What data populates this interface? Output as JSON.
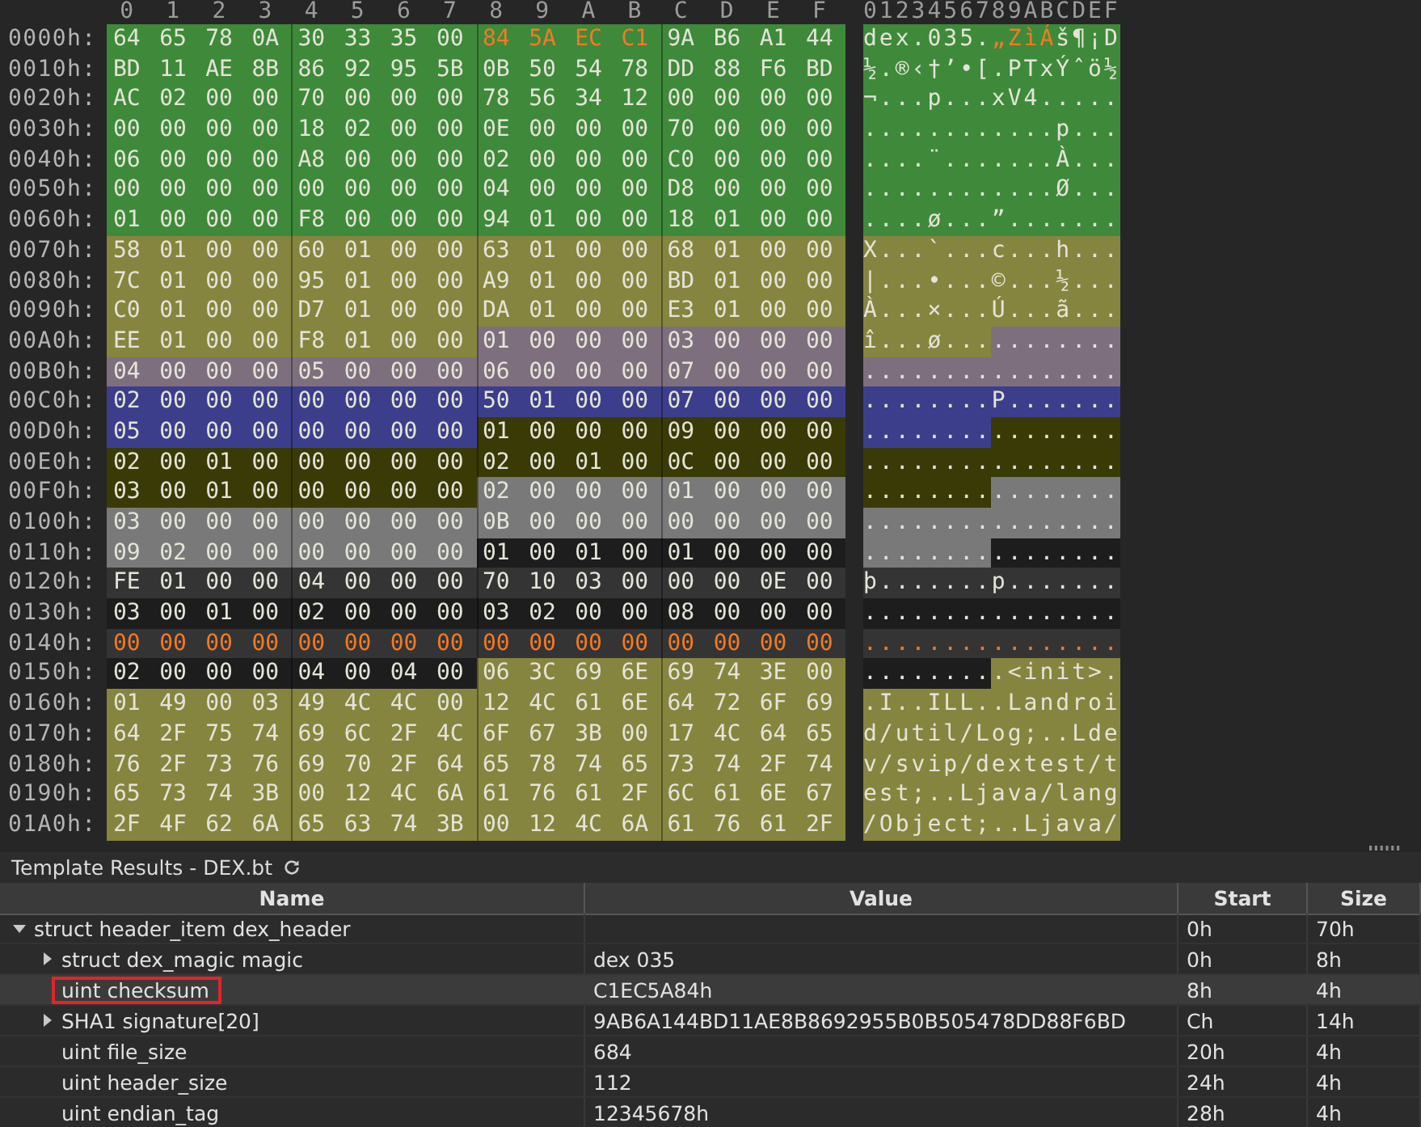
{
  "hex_view": {
    "columns": [
      "0",
      "1",
      "2",
      "3",
      "4",
      "5",
      "6",
      "7",
      "8",
      "9",
      "A",
      "B",
      "C",
      "D",
      "E",
      "F"
    ],
    "ascii_header": "0123456789ABCDEF",
    "rows": [
      {
        "address": "0000h:",
        "spans": [
          {
            "color": "#3e8a3a",
            "selected": false,
            "bytes": [
              "64",
              "65",
              "78",
              "0A",
              "30",
              "33",
              "35",
              "00"
            ],
            "ascii": "dex.035."
          },
          {
            "color": "#3e8a3a",
            "selected": true,
            "bytes": [
              "84",
              "5A",
              "EC",
              "C1"
            ],
            "ascii": "„ZìÁ"
          },
          {
            "color": "#3e8a3a",
            "selected": false,
            "bytes": [
              "9A",
              "B6",
              "A1",
              "44"
            ],
            "ascii": "š¶¡D"
          }
        ]
      },
      {
        "address": "0010h:",
        "spans": [
          {
            "color": "#3e8a3a",
            "selected": false,
            "bytes": [
              "BD",
              "11",
              "AE",
              "8B",
              "86",
              "92",
              "95",
              "5B",
              "0B",
              "50",
              "54",
              "78",
              "DD",
              "88",
              "F6",
              "BD"
            ],
            "ascii": "½.®‹†’•[.PTxÝˆö½"
          }
        ]
      },
      {
        "address": "0020h:",
        "spans": [
          {
            "color": "#3e8a3a",
            "selected": false,
            "bytes": [
              "AC",
              "02",
              "00",
              "00",
              "70",
              "00",
              "00",
              "00",
              "78",
              "56",
              "34",
              "12",
              "00",
              "00",
              "00",
              "00"
            ],
            "ascii": "¬...p...xV4....."
          }
        ]
      },
      {
        "address": "0030h:",
        "spans": [
          {
            "color": "#3e8a3a",
            "selected": false,
            "bytes": [
              "00",
              "00",
              "00",
              "00",
              "18",
              "02",
              "00",
              "00",
              "0E",
              "00",
              "00",
              "00",
              "70",
              "00",
              "00",
              "00"
            ],
            "ascii": "............p..."
          }
        ]
      },
      {
        "address": "0040h:",
        "spans": [
          {
            "color": "#3e8a3a",
            "selected": false,
            "bytes": [
              "06",
              "00",
              "00",
              "00",
              "A8",
              "00",
              "00",
              "00",
              "02",
              "00",
              "00",
              "00",
              "C0",
              "00",
              "00",
              "00"
            ],
            "ascii": "....¨.......À..."
          }
        ]
      },
      {
        "address": "0050h:",
        "spans": [
          {
            "color": "#3e8a3a",
            "selected": false,
            "bytes": [
              "00",
              "00",
              "00",
              "00",
              "00",
              "00",
              "00",
              "00",
              "04",
              "00",
              "00",
              "00",
              "D8",
              "00",
              "00",
              "00"
            ],
            "ascii": "............Ø..."
          }
        ]
      },
      {
        "address": "0060h:",
        "spans": [
          {
            "color": "#3e8a3a",
            "selected": false,
            "bytes": [
              "01",
              "00",
              "00",
              "00",
              "F8",
              "00",
              "00",
              "00",
              "94",
              "01",
              "00",
              "00",
              "18",
              "01",
              "00",
              "00"
            ],
            "ascii": "....ø...”......."
          }
        ]
      },
      {
        "address": "0070h:",
        "spans": [
          {
            "color": "#86853f",
            "selected": false,
            "bytes": [
              "58",
              "01",
              "00",
              "00",
              "60",
              "01",
              "00",
              "00",
              "63",
              "01",
              "00",
              "00",
              "68",
              "01",
              "00",
              "00"
            ],
            "ascii": "X...`...c...h..."
          }
        ]
      },
      {
        "address": "0080h:",
        "spans": [
          {
            "color": "#86853f",
            "selected": false,
            "bytes": [
              "7C",
              "01",
              "00",
              "00",
              "95",
              "01",
              "00",
              "00",
              "A9",
              "01",
              "00",
              "00",
              "BD",
              "01",
              "00",
              "00"
            ],
            "ascii": "|...•...©...½..."
          }
        ]
      },
      {
        "address": "0090h:",
        "spans": [
          {
            "color": "#86853f",
            "selected": false,
            "bytes": [
              "C0",
              "01",
              "00",
              "00",
              "D7",
              "01",
              "00",
              "00",
              "DA",
              "01",
              "00",
              "00",
              "E3",
              "01",
              "00",
              "00"
            ],
            "ascii": "À...×...Ú...ã..."
          }
        ]
      },
      {
        "address": "00A0h:",
        "spans": [
          {
            "color": "#86853f",
            "selected": false,
            "bytes": [
              "EE",
              "01",
              "00",
              "00",
              "F8",
              "01",
              "00",
              "00"
            ],
            "ascii": "î...ø..."
          },
          {
            "color": "#7e6f7e",
            "selected": false,
            "bytes": [
              "01",
              "00",
              "00",
              "00",
              "03",
              "00",
              "00",
              "00"
            ],
            "ascii": "........"
          }
        ]
      },
      {
        "address": "00B0h:",
        "spans": [
          {
            "color": "#7e6f7e",
            "selected": false,
            "bytes": [
              "04",
              "00",
              "00",
              "00",
              "05",
              "00",
              "00",
              "00",
              "06",
              "00",
              "00",
              "00",
              "07",
              "00",
              "00",
              "00"
            ],
            "ascii": "................"
          }
        ]
      },
      {
        "address": "00C0h:",
        "spans": [
          {
            "color": "#3c3e8c",
            "selected": false,
            "bytes": [
              "02",
              "00",
              "00",
              "00",
              "00",
              "00",
              "00",
              "00",
              "50",
              "01",
              "00",
              "00",
              "07",
              "00",
              "00",
              "00"
            ],
            "ascii": "........P......."
          }
        ]
      },
      {
        "address": "00D0h:",
        "spans": [
          {
            "color": "#3c3e8c",
            "selected": false,
            "bytes": [
              "05",
              "00",
              "00",
              "00",
              "00",
              "00",
              "00",
              "00"
            ],
            "ascii": "........"
          },
          {
            "color": "#3a3a06",
            "selected": false,
            "bytes": [
              "01",
              "00",
              "00",
              "00",
              "09",
              "00",
              "00",
              "00"
            ],
            "ascii": "........"
          }
        ]
      },
      {
        "address": "00E0h:",
        "spans": [
          {
            "color": "#3a3a06",
            "selected": false,
            "bytes": [
              "02",
              "00",
              "01",
              "00",
              "00",
              "00",
              "00",
              "00",
              "02",
              "00",
              "01",
              "00",
              "0C",
              "00",
              "00",
              "00"
            ],
            "ascii": "................"
          }
        ]
      },
      {
        "address": "00F0h:",
        "spans": [
          {
            "color": "#3a3a06",
            "selected": false,
            "bytes": [
              "03",
              "00",
              "01",
              "00",
              "00",
              "00",
              "00",
              "00"
            ],
            "ascii": "........"
          },
          {
            "color": "#797979",
            "selected": false,
            "bytes": [
              "02",
              "00",
              "00",
              "00",
              "01",
              "00",
              "00",
              "00"
            ],
            "ascii": "........"
          }
        ]
      },
      {
        "address": "0100h:",
        "spans": [
          {
            "color": "#797979",
            "selected": false,
            "bytes": [
              "03",
              "00",
              "00",
              "00",
              "00",
              "00",
              "00",
              "00",
              "0B",
              "00",
              "00",
              "00",
              "00",
              "00",
              "00",
              "00"
            ],
            "ascii": "................"
          }
        ]
      },
      {
        "address": "0110h:",
        "spans": [
          {
            "color": "#797979",
            "selected": false,
            "bytes": [
              "09",
              "02",
              "00",
              "00",
              "00",
              "00",
              "00",
              "00"
            ],
            "ascii": "........"
          },
          {
            "color": "#1d1d1d",
            "selected": false,
            "bytes": [
              "01",
              "00",
              "01",
              "00",
              "01",
              "00",
              "00",
              "00"
            ],
            "ascii": "........"
          }
        ]
      },
      {
        "address": "0120h:",
        "spans": [
          {
            "color": "#343434",
            "selected": false,
            "bytes": [
              "FE",
              "01",
              "00",
              "00",
              "04",
              "00",
              "00",
              "00",
              "70",
              "10",
              "03",
              "00",
              "00",
              "00",
              "0E",
              "00"
            ],
            "ascii": "þ.......p......."
          }
        ]
      },
      {
        "address": "0130h:",
        "spans": [
          {
            "color": "#1d1d1d",
            "selected": false,
            "bytes": [
              "03",
              "00",
              "01",
              "00",
              "02",
              "00",
              "00",
              "00",
              "03",
              "02",
              "00",
              "00",
              "08",
              "00",
              "00",
              "00"
            ],
            "ascii": "................"
          }
        ]
      },
      {
        "address": "0140h:",
        "spans": [
          {
            "color": "#343434",
            "selected": true,
            "bytes": [
              "00",
              "00",
              "00",
              "00",
              "00",
              "00",
              "00",
              "00",
              "00",
              "00",
              "00",
              "00",
              "00",
              "00",
              "00",
              "00"
            ],
            "ascii": "................"
          }
        ]
      },
      {
        "address": "0150h:",
        "spans": [
          {
            "color": "#1d1d1d",
            "selected": false,
            "bytes": [
              "02",
              "00",
              "00",
              "00",
              "04",
              "00",
              "04",
              "00"
            ],
            "ascii": "........"
          },
          {
            "color": "#86853f",
            "selected": false,
            "bytes": [
              "06",
              "3C",
              "69",
              "6E",
              "69",
              "74",
              "3E",
              "00"
            ],
            "ascii": ".<init>."
          }
        ]
      },
      {
        "address": "0160h:",
        "spans": [
          {
            "color": "#86853f",
            "selected": false,
            "bytes": [
              "01",
              "49",
              "00",
              "03",
              "49",
              "4C",
              "4C",
              "00",
              "12",
              "4C",
              "61",
              "6E",
              "64",
              "72",
              "6F",
              "69"
            ],
            "ascii": ".I..ILL..Landroi"
          }
        ]
      },
      {
        "address": "0170h:",
        "spans": [
          {
            "color": "#86853f",
            "selected": false,
            "bytes": [
              "64",
              "2F",
              "75",
              "74",
              "69",
              "6C",
              "2F",
              "4C",
              "6F",
              "67",
              "3B",
              "00",
              "17",
              "4C",
              "64",
              "65"
            ],
            "ascii": "d/util/Log;..Lde"
          }
        ]
      },
      {
        "address": "0180h:",
        "spans": [
          {
            "color": "#86853f",
            "selected": false,
            "bytes": [
              "76",
              "2F",
              "73",
              "76",
              "69",
              "70",
              "2F",
              "64",
              "65",
              "78",
              "74",
              "65",
              "73",
              "74",
              "2F",
              "74"
            ],
            "ascii": "v/svip/dextest/t"
          }
        ]
      },
      {
        "address": "0190h:",
        "spans": [
          {
            "color": "#86853f",
            "selected": false,
            "bytes": [
              "65",
              "73",
              "74",
              "3B",
              "00",
              "12",
              "4C",
              "6A",
              "61",
              "76",
              "61",
              "2F",
              "6C",
              "61",
              "6E",
              "67"
            ],
            "ascii": "est;..Ljava/lang"
          }
        ]
      },
      {
        "address": "01A0h:",
        "spans": [
          {
            "color": "#86853f",
            "selected": false,
            "bytes": [
              "2F",
              "4F",
              "62",
              "6A",
              "65",
              "63",
              "74",
              "3B",
              "00",
              "12",
              "4C",
              "6A",
              "61",
              "76",
              "61",
              "2F"
            ],
            "ascii": "/Object;..Ljava/"
          }
        ]
      }
    ]
  },
  "template_results": {
    "title": "Template Results - DEX.bt",
    "columns": [
      "Name",
      "Value",
      "Start",
      "Size"
    ],
    "rows": [
      {
        "kind": "struct",
        "name": "struct header_item dex_header",
        "start": "0h",
        "size": "70h",
        "expanded": true,
        "selected": false,
        "outlined": false,
        "children": [
          {
            "kind": "struct",
            "name": "struct dex_magic magic",
            "value": "dex 035",
            "start": "0h",
            "size": "8h",
            "expanded": false,
            "selected": false,
            "outlined": false
          },
          {
            "kind": "field",
            "name": "uint checksum",
            "value": "C1EC5A84h",
            "start": "8h",
            "size": "4h",
            "selected": true,
            "outlined": true
          },
          {
            "kind": "struct",
            "name": "SHA1 signature[20]",
            "value": "9AB6A144BD11AE8B8692955B0B505478DD88F6BD",
            "start": "Ch",
            "size": "14h",
            "expanded": false,
            "selected": false,
            "outlined": false
          },
          {
            "kind": "field",
            "name": "uint file_size",
            "value": "684",
            "start": "20h",
            "size": "4h",
            "selected": false,
            "outlined": false
          },
          {
            "kind": "field",
            "name": "uint header_size",
            "value": "112",
            "start": "24h",
            "size": "4h",
            "selected": false,
            "outlined": false
          },
          {
            "kind": "field",
            "name": "uint endian_tag",
            "value": "12345678h",
            "start": "28h",
            "size": "4h",
            "selected": false,
            "outlined": false
          }
        ]
      }
    ]
  }
}
